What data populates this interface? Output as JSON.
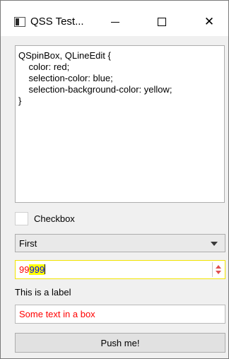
{
  "window": {
    "title": "QSS Test...",
    "icon": "app-window-icon",
    "controls": {
      "minimize": "minimize-icon",
      "maximize": "maximize-icon",
      "close": "close-icon",
      "close_glyph": "✕"
    }
  },
  "stylesheet_editor": {
    "text": "QSpinBox, QLineEdit {\n    color: red;\n    selection-color: blue;\n    selection-background-color: yellow;\n}"
  },
  "checkbox": {
    "label": "Checkbox",
    "checked": false
  },
  "combobox": {
    "selected": "First"
  },
  "spinbox": {
    "text_normal": "99",
    "text_selected": "999"
  },
  "label": {
    "text": "This is a label"
  },
  "line_edit": {
    "value": "Some text in a box"
  },
  "push_button": {
    "label": "Push me!"
  },
  "colors": {
    "text_red": "#ff0000",
    "selection_blue": "#0000ff",
    "selection_bg_yellow": "#ffff00",
    "spin_border": "#f2e400"
  }
}
